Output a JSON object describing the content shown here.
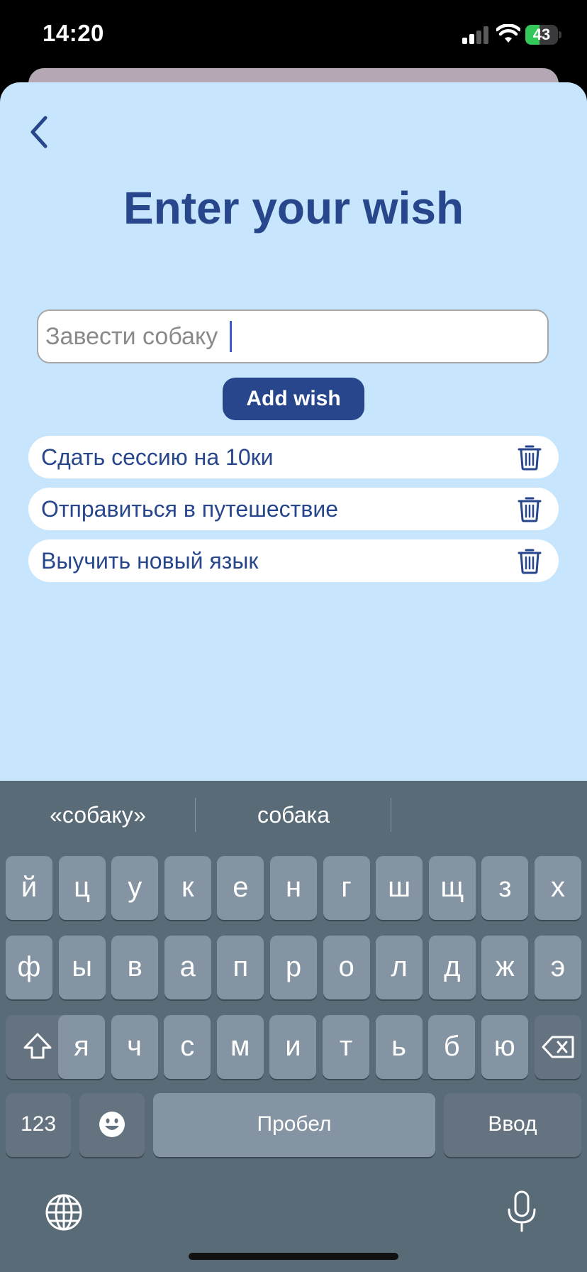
{
  "status_bar": {
    "time": "14:20",
    "battery": "43",
    "battery_level": 0.43
  },
  "screen": {
    "title": "Enter your wish"
  },
  "input": {
    "value": "Завести собаку"
  },
  "add_button": {
    "label": "Add wish"
  },
  "wishes": [
    {
      "label": "Сдать сессию на 10ки"
    },
    {
      "label": "Отправиться в путешествие"
    },
    {
      "label": "Выучить новый язык"
    }
  ],
  "keyboard": {
    "suggestions": [
      "«собаку»",
      "собака",
      ""
    ],
    "row1": [
      "й",
      "ц",
      "у",
      "к",
      "е",
      "н",
      "г",
      "ш",
      "щ",
      "з",
      "х"
    ],
    "row2": [
      "ф",
      "ы",
      "в",
      "а",
      "п",
      "р",
      "о",
      "л",
      "д",
      "ж",
      "э"
    ],
    "row3": [
      "я",
      "ч",
      "с",
      "м",
      "и",
      "т",
      "ь",
      "б",
      "ю"
    ],
    "numbers_label": "123",
    "space_label": "Пробел",
    "return_label": "Ввод"
  },
  "colors": {
    "sheet_bg": "#c7e5fc",
    "accent": "#27468c",
    "keyboard_bg": "#5a6b78"
  }
}
